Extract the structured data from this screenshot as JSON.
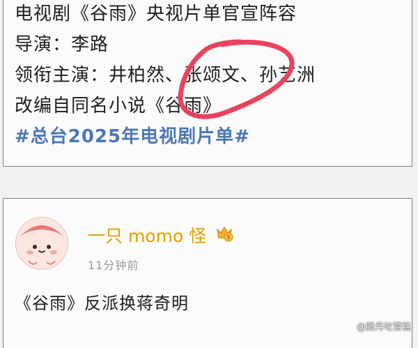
{
  "post": {
    "line1": "电视剧《谷雨》央视片单官宣阵容",
    "line2": "导演：李路",
    "line3": "领衔主演：井柏然、张颂文、孙艺洲",
    "line4": "改编自同名小说《谷雨》",
    "hashtag": "#总台2025年电视剧片单#",
    "highlight_color": "#e8445f"
  },
  "comment": {
    "username": "一只 momo 怪",
    "badge_icon": "crown-vip-icon",
    "timestamp": "11分钟前",
    "text": "《谷雨》反派换蒋奇明"
  },
  "watermark": "@腊月吃菅糕",
  "colors": {
    "username": "#e0a000",
    "hashtag": "#4c78b4"
  }
}
